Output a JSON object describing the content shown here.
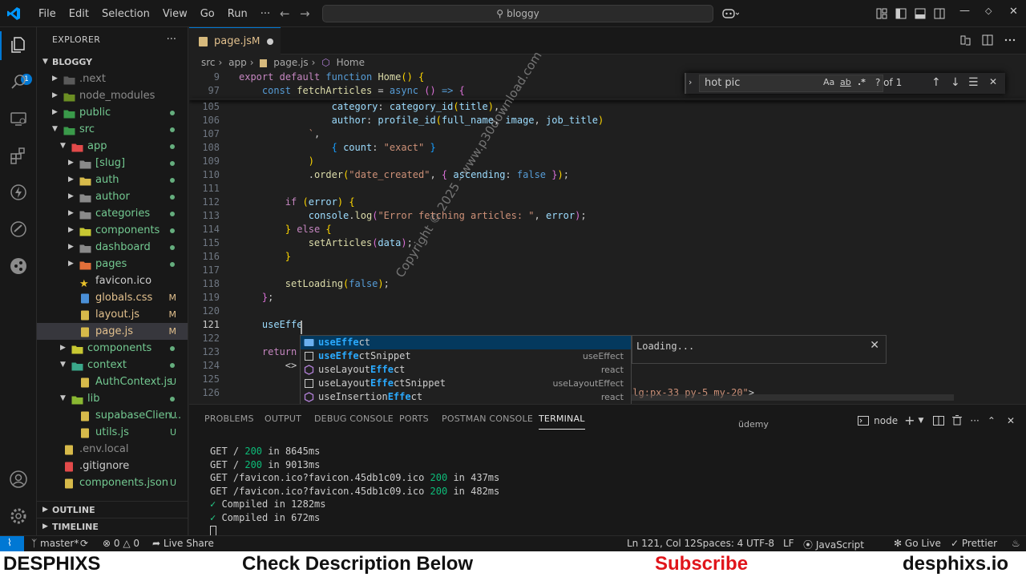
{
  "titlebar": {
    "menu": [
      "File",
      "Edit",
      "Selection",
      "View",
      "Go",
      "Run",
      "···"
    ],
    "search": "bloggy"
  },
  "activity": {
    "explorer_badge": "1"
  },
  "sidebar": {
    "title": "EXPLORER",
    "root": "BLOGGY",
    "items": [
      {
        "name": ".next",
        "status": "",
        "color": "#8b8b8b"
      },
      {
        "name": "node_modules",
        "status": "",
        "color": "#8b8b8b"
      },
      {
        "name": "public",
        "status": "",
        "color": "#73c991"
      },
      {
        "name": "src",
        "status": "",
        "color": "#73c991"
      },
      {
        "name": "app",
        "status": "",
        "color": "#73c991"
      },
      {
        "name": "[slug]",
        "status": "",
        "color": "#73c991"
      },
      {
        "name": "auth",
        "status": "",
        "color": "#73c991"
      },
      {
        "name": "author",
        "status": "",
        "color": "#73c991"
      },
      {
        "name": "categories",
        "status": "",
        "color": "#73c991"
      },
      {
        "name": "components",
        "status": "",
        "color": "#73c991"
      },
      {
        "name": "dashboard",
        "status": "",
        "color": "#73c991"
      },
      {
        "name": "pages",
        "status": "",
        "color": "#73c991"
      },
      {
        "name": "favicon.ico",
        "status": "",
        "color": "#cccccc"
      },
      {
        "name": "globals.css",
        "status": "M",
        "color": "#e2c08d"
      },
      {
        "name": "layout.js",
        "status": "M",
        "color": "#e2c08d"
      },
      {
        "name": "page.js",
        "status": "M",
        "color": "#e2c08d"
      },
      {
        "name": "components",
        "status": "",
        "color": "#73c991"
      },
      {
        "name": "context",
        "status": "",
        "color": "#73c991"
      },
      {
        "name": "AuthContext.js",
        "status": "U",
        "color": "#73c991"
      },
      {
        "name": "lib",
        "status": "",
        "color": "#73c991"
      },
      {
        "name": "supabaseClien...",
        "status": "U",
        "color": "#73c991"
      },
      {
        "name": "utils.js",
        "status": "U",
        "color": "#73c991"
      },
      {
        "name": ".env.local",
        "status": "",
        "color": "#8b8b8b"
      },
      {
        "name": ".gitignore",
        "status": "",
        "color": "#cccccc"
      },
      {
        "name": "components.json",
        "status": "U",
        "color": "#73c991"
      }
    ],
    "outline": "OUTLINE",
    "timeline": "TIMELINE"
  },
  "tab": {
    "name": "page.js",
    "modified": "M"
  },
  "breadcrumb": [
    "src",
    "app",
    "page.js",
    "Home"
  ],
  "find": {
    "query": "hot pic",
    "count": "? of 1",
    "case": "Aa",
    "word": "ab",
    "regex": ".*"
  },
  "editor": {
    "line_numbers": [
      "9",
      "97",
      "105",
      "106",
      "107",
      "108",
      "109",
      "110",
      "111",
      "112",
      "113",
      "114",
      "115",
      "116",
      "117",
      "118",
      "119",
      "120",
      "121",
      "122",
      "123",
      "124",
      "125",
      "126"
    ],
    "typed": "useEffe"
  },
  "suggest": {
    "items": [
      {
        "pre": "",
        "match": "useEffe",
        "post": "ct",
        "detail": ""
      },
      {
        "pre": "",
        "match": "useEffe",
        "post": "ctSnippet",
        "detail": "useEffect"
      },
      {
        "pre": "useLayout",
        "match": "Effe",
        "post": "ct",
        "detail": "react"
      },
      {
        "pre": "useLayout",
        "match": "Effe",
        "post": "ctSnippet",
        "detail": "useLayoutEffect"
      },
      {
        "pre": "useInsertion",
        "match": "Effe",
        "post": "ct",
        "detail": "react"
      }
    ],
    "docs": "Loading..."
  },
  "panel": {
    "tabs": [
      "PROBLEMS",
      "OUTPUT",
      "DEBUG CONSOLE",
      "PORTS",
      "POSTMAN CONSOLE",
      "TERMINAL"
    ],
    "watermark": "üdemy",
    "shell": "node"
  },
  "terminal": [
    {
      "a": "GET / ",
      "n": "200",
      "b": " in 8645ms"
    },
    {
      "a": "GET / ",
      "n": "200",
      "b": " in 9013ms"
    },
    {
      "a": "GET /favicon.ico?favicon.45db1c09.ico ",
      "n": "200",
      "b": " in 437ms"
    },
    {
      "a": "GET /favicon.ico?favicon.45db1c09.ico ",
      "n": "200",
      "b": " in 482ms"
    }
  ],
  "compiled": [
    "Compiled in 1282ms",
    "Compiled in 672ms"
  ],
  "status": {
    "branch": "master*",
    "errors": "0",
    "warnings": "0",
    "liveshare": "Live Share",
    "position": "Ln 121, Col 12",
    "spaces": "Spaces: 4",
    "encoding": "UTF-8",
    "eol": "LF",
    "language": "JavaScript",
    "golive": "Go Live",
    "prettier": "Prettier"
  },
  "watermark_text": "Copyright © 2025 - www.p30download.com",
  "banner": {
    "left": "DESPHIXS",
    "center": "Check Description Below",
    "subscribe": "Subscribe",
    "right": "desphixs.io",
    "subscribe_color": "#e0151b"
  }
}
